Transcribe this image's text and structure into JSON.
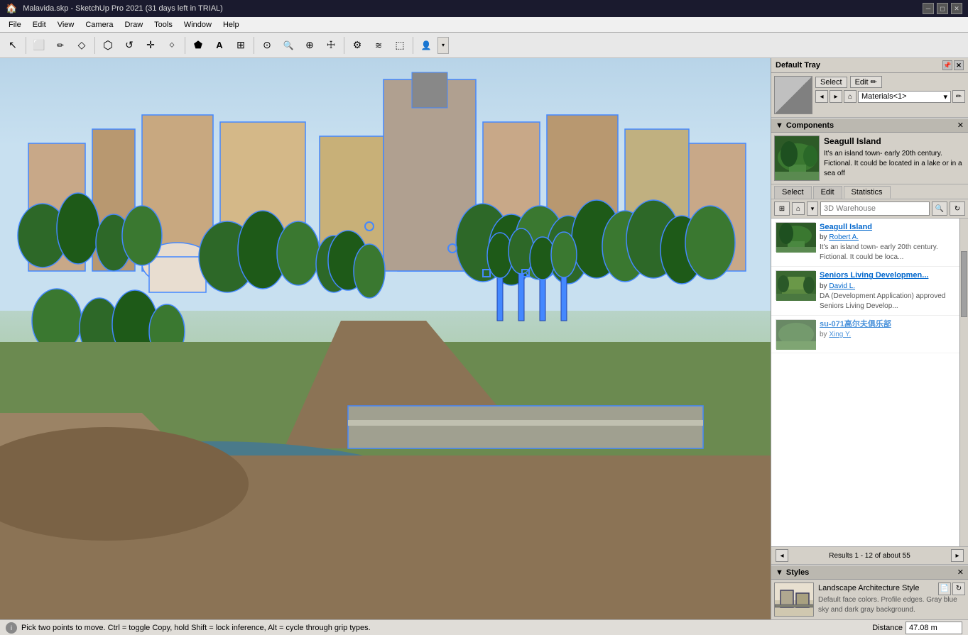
{
  "app": {
    "title": "Malavida.skp - SketchUp Pro 2021 (31 days left in TRIAL)",
    "win_minimize": "─",
    "win_restore": "◻",
    "win_close": "✕"
  },
  "menubar": {
    "items": [
      "File",
      "Edit",
      "View",
      "Camera",
      "Draw",
      "Tools",
      "Window",
      "Help"
    ]
  },
  "toolbar": {
    "tools": [
      {
        "name": "select-tool",
        "icon": "↖",
        "label": "Select"
      },
      {
        "name": "eraser-tool",
        "icon": "⬜",
        "label": "Eraser"
      },
      {
        "name": "pencil-tool",
        "icon": "✏",
        "label": "Pencil"
      },
      {
        "name": "shape-tool",
        "icon": "◇",
        "label": "Shape"
      },
      {
        "name": "push-pull-tool",
        "icon": "⬡",
        "label": "Push/Pull"
      },
      {
        "name": "rotate-tool",
        "icon": "↺",
        "label": "Rotate"
      },
      {
        "name": "move-tool",
        "icon": "✛",
        "label": "Move"
      },
      {
        "name": "offset-tool",
        "icon": "⬟",
        "label": "Offset"
      },
      {
        "name": "text-tool",
        "icon": "A",
        "label": "Text"
      },
      {
        "name": "dimension-tool",
        "icon": "⊞",
        "label": "Dimension"
      },
      {
        "name": "orbit-tool",
        "icon": "⊙",
        "label": "Orbit"
      },
      {
        "name": "zoom-tool",
        "icon": "🔍",
        "label": "Zoom"
      },
      {
        "name": "pan-tool",
        "icon": "✋",
        "label": "Pan"
      },
      {
        "name": "walk-tool",
        "icon": "⬦",
        "label": "Walk"
      },
      {
        "name": "settings-tool",
        "icon": "⚙",
        "label": "Model Settings"
      },
      {
        "name": "layers-tool",
        "icon": "≡",
        "label": "Layers"
      },
      {
        "name": "scenes-tool",
        "icon": "🎬",
        "label": "Scenes"
      },
      {
        "name": "person-tool",
        "icon": "👤",
        "label": "Person"
      }
    ]
  },
  "tray": {
    "title": "Default Tray"
  },
  "materials": {
    "select_label": "Select",
    "edit_label": "Edit",
    "dropdown_value": "Materials<1>",
    "pencil_icon": "✏"
  },
  "components": {
    "section_title": "Components",
    "selected": {
      "name": "Seagull Island",
      "description": "It's an island town- early 20th century. Fictional. It could be located in a lake or in a sea off"
    },
    "tabs": {
      "select_label": "Select",
      "edit_label": "Edit",
      "statistics_label": "Statistics"
    },
    "search": {
      "source": "3D Warehouse",
      "placeholder": "Search 3D Warehouse"
    },
    "results": [
      {
        "name": "Seagull Island",
        "author": "Robert A.",
        "description": "It's an island town- early 20th century. Fictional. It could be loca..."
      },
      {
        "name": "Seniors Living Developmen...",
        "author": "David L.",
        "description": "DA (Development Application) approved Seniors Living Develop..."
      },
      {
        "name": "su-071高尔夫俱乐部",
        "author": "Xing Y.",
        "description": ""
      }
    ],
    "results_text": "Results 1 - 12 of about 55"
  },
  "styles": {
    "section_title": "Styles",
    "current": {
      "name": "Landscape Architecture Style",
      "description": "Default face colors. Profile edges. Gray blue sky and dark gray background."
    }
  },
  "statusbar": {
    "message": "Pick two points to move.  Ctrl = toggle Copy, hold Shift = lock inference, Alt = cycle through grip types.",
    "distance_label": "Distance",
    "distance_value": "47.08 m"
  }
}
